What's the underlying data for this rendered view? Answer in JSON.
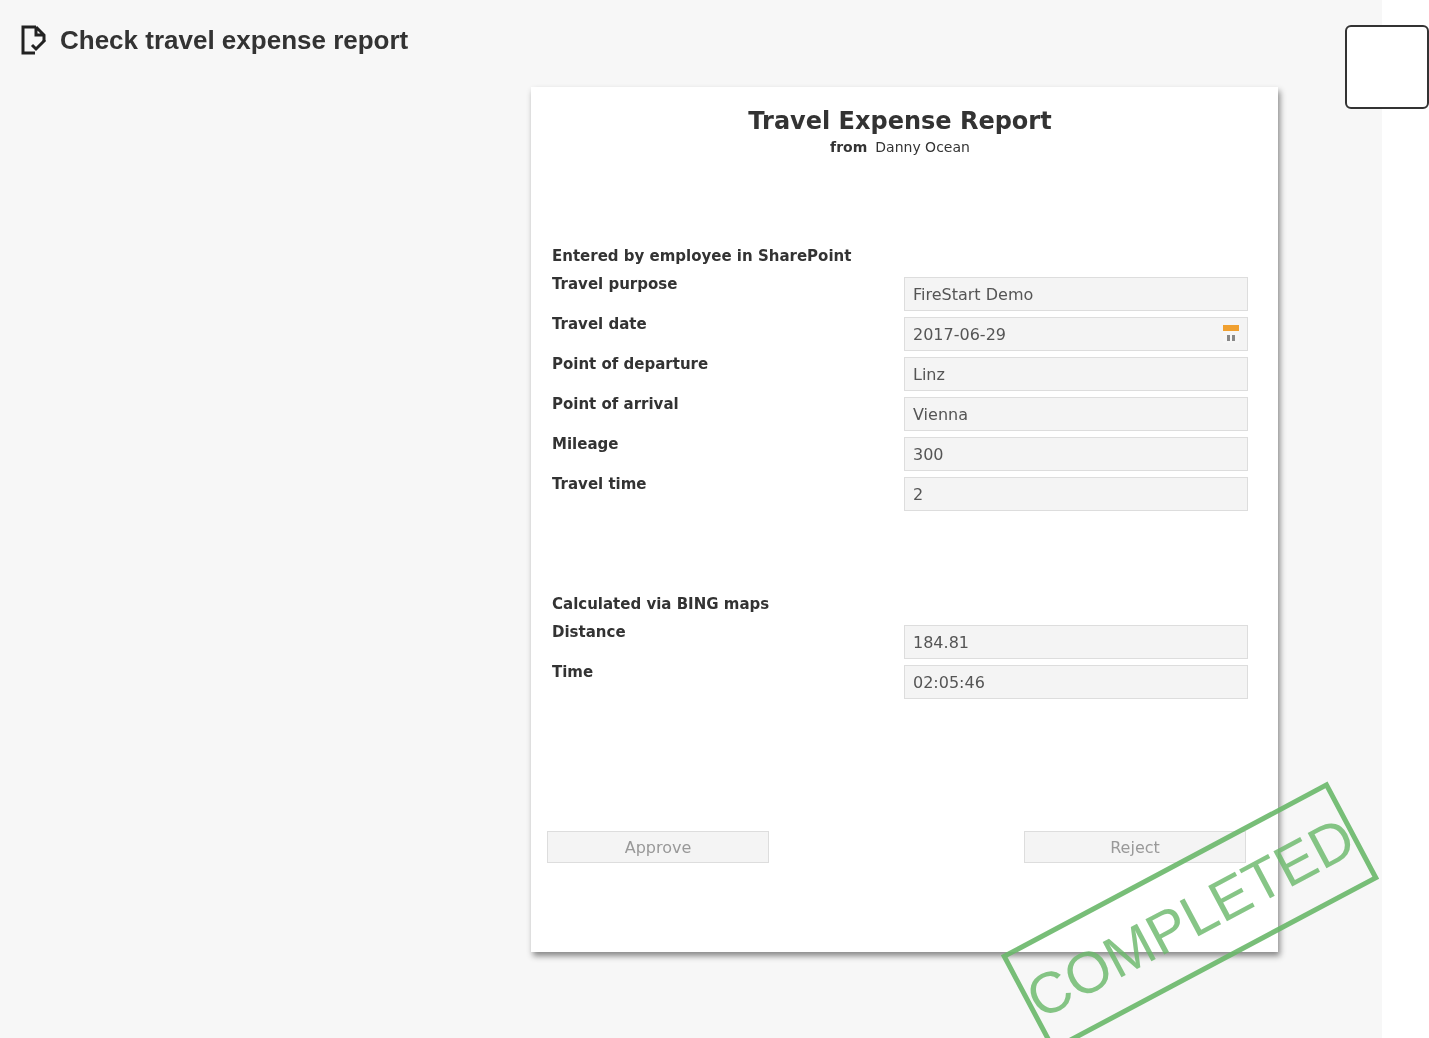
{
  "header": {
    "title": "Check travel expense report"
  },
  "form": {
    "title": "Travel Expense Report",
    "from_label": "from",
    "from_name": "Danny Ocean",
    "sections": [
      {
        "heading": "Entered by employee in SharePoint",
        "fields": [
          {
            "label": "Travel purpose",
            "value": "FireStart Demo",
            "kind": "text"
          },
          {
            "label": "Travel date",
            "value": "2017-06-29",
            "kind": "date"
          },
          {
            "label": "Point of departure",
            "value": "Linz",
            "kind": "text"
          },
          {
            "label": "Point of arrival",
            "value": "Vienna",
            "kind": "text"
          },
          {
            "label": "Mileage",
            "value": "300",
            "kind": "text"
          },
          {
            "label": "Travel time",
            "value": "2",
            "kind": "text"
          }
        ]
      },
      {
        "heading": "Calculated via BING maps",
        "fields": [
          {
            "label": "Distance",
            "value": "184.81",
            "kind": "text"
          },
          {
            "label": "Time",
            "value": "02:05:46",
            "kind": "text"
          }
        ]
      }
    ],
    "buttons": [
      {
        "label": "Approve",
        "disabled": true
      },
      {
        "label": "Reject",
        "disabled": true
      }
    ]
  },
  "stamp": {
    "text": "COMPLETED"
  }
}
